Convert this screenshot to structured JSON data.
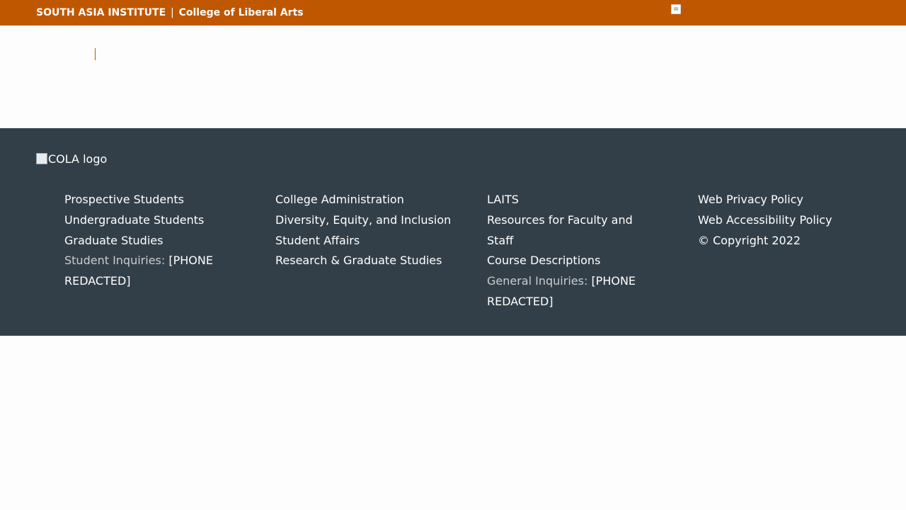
{
  "topbar": {
    "institute": "SOUTH ASIA INSTITUTE",
    "separator": "|",
    "college": "College of Liberal Arts"
  },
  "footer": {
    "logo_alt": "COLA logo",
    "columns": [
      {
        "links": [
          "Prospective Students",
          "Undergraduate Students",
          "Graduate Studies"
        ],
        "inquiry_label": "Student Inquiries:",
        "inquiry_value": "[PHONE REDACTED]"
      },
      {
        "links": [
          "College Administration",
          "Diversity, Equity, and Inclusion",
          "Student Affairs",
          "Research & Graduate Studies"
        ]
      },
      {
        "links": [
          "LAITS",
          "Resources for Faculty and Staff",
          "Course Descriptions"
        ],
        "inquiry_label": "General Inquiries:",
        "inquiry_value": "[PHONE REDACTED]"
      },
      {
        "links": [
          "Web Privacy Policy",
          "Web Accessibility Policy",
          "© Copyright 2022"
        ]
      }
    ]
  },
  "colors": {
    "brand_orange": "#bf5700",
    "footer_bg": "#333f48"
  }
}
